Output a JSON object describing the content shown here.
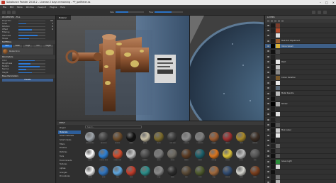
{
  "window": {
    "title": "Substance Painter 2018.2 - License 2 days remaining - *P_ipeMeter.ss"
  },
  "menu": [
    "File",
    "Edit",
    "Mode",
    "Window",
    "Viewport",
    "Plugins",
    "Help"
  ],
  "toolbar": {
    "size_label": "Size",
    "flow_label": "Flow",
    "size_pct": 0.45,
    "flow_pct": 0.6
  },
  "properties": {
    "title": "PROPERTIES - FILL",
    "rows": [
      {
        "label": "Projection",
        "value": "UV",
        "fill": 0.0
      },
      {
        "label": "Scale",
        "value": "1",
        "fill": 0.3
      },
      {
        "label": "Rotation",
        "value": "0",
        "fill": 0.0
      },
      {
        "label": "Offset",
        "value": "0",
        "fill": 0.5
      },
      {
        "label": "Filtering",
        "value": "",
        "fill": 0.0
      },
      {
        "label": "Hardness",
        "value": "",
        "fill": 0.7
      },
      {
        "label": "Shape",
        "value": "",
        "fill": 0.4
      }
    ],
    "material_section": "MATERIAL",
    "material_tabs": [
      "color",
      "metal",
      "rough",
      "nrm",
      "height"
    ],
    "material_name": "Rusted Iron",
    "param_section": "Parameters",
    "params": [
      {
        "label": "Color",
        "value": "",
        "fill": 0.6
      },
      {
        "label": "Roughness",
        "value": "",
        "fill": 0.45
      },
      {
        "label": "Metallic",
        "value": "",
        "fill": 0.8
      },
      {
        "label": "Normal",
        "value": "",
        "fill": 0.3
      },
      {
        "label": "Height",
        "value": "",
        "fill": 0.5
      }
    ],
    "bottom_section": "Base Parameters",
    "bottom_button": "Presets"
  },
  "viewport3d": {
    "label": "Material"
  },
  "viewport2d": {
    "label": ""
  },
  "shelf": {
    "title": "SHELF",
    "search_placeholder": "Search...",
    "categories": [
      "Project",
      "Materials",
      "Smart materials",
      "Smart masks",
      "Filters",
      "Brushes",
      "Particles",
      "Tools",
      "Environments",
      "Textures",
      "Alphas",
      "Grunges",
      "Procedurals"
    ],
    "active_category": 1,
    "materials": [
      {
        "name": "Aluminium",
        "color": "#9ea4aa"
      },
      {
        "name": "Artificial",
        "color": "#444"
      },
      {
        "name": "Bronze",
        "color": "#6b4b2a"
      },
      {
        "name": "Black",
        "color": "#111"
      },
      {
        "name": "Bone",
        "color": "#c8bfa4"
      },
      {
        "name": "Brass",
        "color": "#7b6a2b"
      },
      {
        "name": "Cast Iron",
        "color": "#3c3c3c"
      },
      {
        "name": "Chrome",
        "color": "#8e8e8e"
      },
      {
        "name": "Concrete",
        "color": "#7f7f7f"
      },
      {
        "name": "Copper",
        "color": "#9a5a30"
      },
      {
        "name": "Fabric",
        "color": "#9e2f2f"
      },
      {
        "name": "Gold",
        "color": "#a68627"
      },
      {
        "name": "Leather",
        "color": "#3a2c22"
      },
      {
        "name": "Plastic",
        "color": "#ffffff"
      },
      {
        "name": "Plastic blue",
        "color": "#2c7fd3"
      },
      {
        "name": "Plastic red",
        "color": "#d04a2a"
      },
      {
        "name": "Paint",
        "color": "#c3c3c3"
      },
      {
        "name": "Rubber",
        "color": "#4a4a4a"
      },
      {
        "name": "Steel",
        "color": "#7a7a7a"
      },
      {
        "name": "Stone",
        "color": "#6e6a62"
      },
      {
        "name": "Wood",
        "color": "#5b3b22"
      },
      {
        "name": "Glass",
        "color": "#1a5f6a"
      },
      {
        "name": "Orange",
        "color": "#d8741d"
      },
      {
        "name": "Yellow",
        "color": "#dbc13a"
      },
      {
        "name": "Silver",
        "color": "#bdbdbd"
      },
      {
        "name": "Iron",
        "color": "#555"
      },
      {
        "name": "White",
        "color": "#efefef"
      },
      {
        "name": "Blue",
        "color": "#2f74c0"
      },
      {
        "name": "Sky",
        "color": "#5da6df"
      },
      {
        "name": "Red",
        "color": "#c43c2a"
      },
      {
        "name": "Teal",
        "color": "#2a8e8a"
      },
      {
        "name": "Grey",
        "color": "#8a8a8a"
      },
      {
        "name": "Dark",
        "color": "#2a2a2a"
      },
      {
        "name": "Dirt",
        "color": "#5a4a36"
      },
      {
        "name": "Olive",
        "color": "#4e5a2c"
      },
      {
        "name": "Clay",
        "color": "#a0683c"
      },
      {
        "name": "Denim",
        "color": "#2f4a70"
      },
      {
        "name": "Pearl",
        "color": "#d6d6d0"
      },
      {
        "name": "Rust",
        "color": "#7a3e1c"
      }
    ]
  },
  "layers": {
    "title": "LAYERS",
    "items": [
      {
        "name": "",
        "pct": "",
        "t1": "#1a1a1a",
        "t2": "#7a3b2a"
      },
      {
        "name": "",
        "pct": "",
        "t1": "#222",
        "t2": "#b54a2a"
      },
      {
        "name": "",
        "pct": "",
        "t1": "#2a2a2a",
        "t2": "#e0e0e0"
      },
      {
        "name": "Rust Dirt Adjustment",
        "pct": "",
        "t1": "#1b1b1b",
        "t2": "#9a5b2c"
      },
      {
        "name": "Yellow Splash",
        "pct": "",
        "t1": "#000",
        "t2": "#d8b23a",
        "sel": true
      },
      {
        "name": "",
        "pct": "",
        "t1": "#111",
        "t2": "#4a4a4a"
      },
      {
        "name": "",
        "pct": "",
        "t1": "#222",
        "t2": "#3a3a3a"
      },
      {
        "name": "Paint",
        "pct": "",
        "t1": "#191919",
        "t2": "#e8e8e8"
      },
      {
        "name": "",
        "pct": "",
        "t1": "#1c1c1c",
        "t2": "#c6c6c6"
      },
      {
        "name": "",
        "pct": "",
        "t1": "#111",
        "t2": "#8a8a8a"
      },
      {
        "name": "Colour Variation",
        "pct": "",
        "t1": "#2a2a2a",
        "t2": "#7a5a2c"
      },
      {
        "name": "",
        "pct": "",
        "t1": "#1a1a1a",
        "t2": "#e9e9e9"
      },
      {
        "name": "",
        "pct": "",
        "t1": "#222",
        "t2": "#5a6a7a"
      },
      {
        "name": "Metal Speckle",
        "pct": "",
        "t1": "#1b1b1b",
        "t2": "#bdbdbd"
      },
      {
        "name": "",
        "pct": "",
        "t1": "#111",
        "t2": "#3a3a3a"
      },
      {
        "name": "Shinier",
        "pct": "",
        "t1": "#000",
        "t2": "#aaaaaa"
      },
      {
        "name": "",
        "pct": "",
        "t1": "#1e1e1e",
        "t2": "#2f2f2f"
      },
      {
        "name": "",
        "pct": "",
        "t1": "#151515",
        "t2": "#e1e1e1"
      },
      {
        "name": "",
        "pct": "",
        "t1": "#222",
        "t2": "#383838"
      },
      {
        "name": "",
        "pct": "",
        "t1": "#111",
        "t2": "#545454"
      },
      {
        "name": "Main Label",
        "pct": "",
        "t1": "#1a1a1a",
        "t2": "#c9c9c9"
      },
      {
        "name": "",
        "pct": "",
        "t1": "#1a1a1a",
        "t2": "#e6e6e6"
      },
      {
        "name": "",
        "pct": "",
        "t1": "#111",
        "t2": "#2f2f2f"
      },
      {
        "name": "",
        "pct": "",
        "t1": "#222",
        "t2": "#6a6a6a"
      },
      {
        "name": "",
        "pct": "",
        "t1": "#1b1b1b",
        "t2": "#404040"
      },
      {
        "name": "",
        "pct": "",
        "t1": "#111",
        "t2": "#595959"
      },
      {
        "name": "Green Light",
        "pct": "",
        "t1": "#151515",
        "t2": "#2a8d3a"
      },
      {
        "name": "",
        "pct": "",
        "t1": "#1a1a1a",
        "t2": "#d8d8d8"
      },
      {
        "name": "",
        "pct": "",
        "t1": "#111",
        "t2": "#333"
      },
      {
        "name": "",
        "pct": "",
        "t1": "#222",
        "t2": "#777"
      },
      {
        "name": "",
        "pct": "",
        "t1": "#1a1a1a",
        "t2": "#b0b0b0"
      }
    ]
  }
}
